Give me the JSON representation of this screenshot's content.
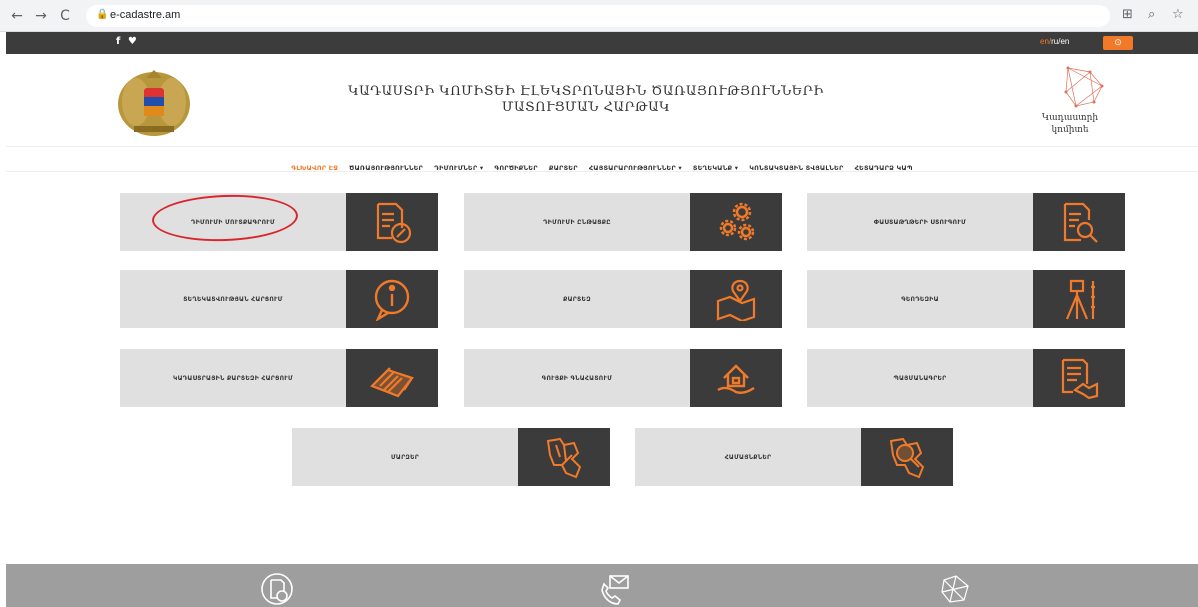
{
  "browser": {
    "back": "←",
    "forward": "→",
    "reload": "C",
    "url": "e-cadastre.am"
  },
  "topbar": {
    "social": "f ♥",
    "lang_active": "en/",
    "lang_rest": "ru/en"
  },
  "header": {
    "title_line1": "ԿԱԴԱՍՏՐԻ ԿՈՄԻՏԵԻ ԷԼԵԿՏՐՈՆԱՅԻՆ ԾԱՌԱՅՈՒԹՅՈՒՆՆԵՐԻ",
    "title_line2": "ՄԱՏՈՒՑՄԱՆ ՀԱՐԹԱԿ",
    "logo_text1": "Կադաստրի",
    "logo_text2": "կոմիտե"
  },
  "menu": {
    "items": [
      "ԳԼԽԱՎՈՐ ԷՋ",
      "ԾԱՌԱՅՈՒԹՅՈՒՆՆԵՐ",
      "ԴԻՄՈՒՄՆԵՐ ▾",
      "ԳՈՐԾԻՔՆԵՐ",
      "ՔԱՐՏԵՐ",
      "ՀԱՅՏԱՐԱՐՈՒԹՅՈՒՆՆԵՐ ▾",
      "ՏԵՂԵԿԱՆՔ ▾",
      "ԿՈՆՏԱԿՏԱՅԻՆ ՏՎՅԱԼՆԵՐ",
      "ՀԵՏԱԴԱՐՁ ԿԱՊ"
    ],
    "active_index": 0
  },
  "tiles": [
    {
      "label": "ԴԻՄՈՒՄԻ ՄՈՒՏՔԱԳՐՈՒՄ",
      "icon": "document-edit-icon"
    },
    {
      "label": "ԴԻՄՈՒՄԻ ԸՆԹԱՑՔԸ",
      "icon": "gears-icon"
    },
    {
      "label": "ՓԱՍՏԱԹՂԹԵՐԻ ՍՏՈՒԳՈՒՄ",
      "icon": "document-search-icon"
    },
    {
      "label": "ՏԵՂԵԿԱՏՎՈՒԹՅԱՆ ՀԱՐՑՈՒՄ",
      "icon": "info-chat-icon"
    },
    {
      "label": "ՔԱՐՏԵԶ",
      "icon": "map-pin-icon"
    },
    {
      "label": "ԳԵՈԴԵԶԻԱ",
      "icon": "theodolite-icon"
    },
    {
      "label": "ԿԱԴԱՍՏՐԱՅԻՆ ՔԱՐՏԵԶԻ ՀԱՐՑՈՒՄ",
      "icon": "layers-map-icon"
    },
    {
      "label": "ԳՈՒՅՔԻ ԳՆԱՀԱՏՈՒՄ",
      "icon": "house-hand-icon"
    },
    {
      "label": "ՊԱՅՄԱՆԱԳՐԵՐ",
      "icon": "contract-handshake-icon"
    },
    {
      "label": "ՄԱՐԶԵՐ",
      "icon": "armenia-map-icon"
    },
    {
      "label": "ՀԱՄԱՅՆՔՆԵՐ",
      "icon": "armenia-map-search-icon"
    }
  ],
  "colors": {
    "accent": "#f07a2a",
    "tile_bg": "#e0e0e0",
    "icon_bg": "#3b3b3b",
    "annotation": "#d9262c"
  }
}
